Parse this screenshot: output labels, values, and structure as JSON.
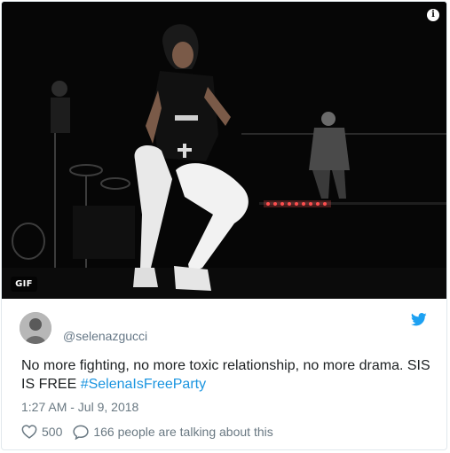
{
  "media": {
    "badge": "GIF",
    "info_icon": "info-icon",
    "alt_description_icon": "i"
  },
  "tweet": {
    "handle": "@selenazgucci",
    "text_main": "No more fighting, no more toxic relationship, no more drama. SIS IS FREE ",
    "hashtag": "#SelenaIsFreeParty",
    "timestamp": "1:27 AM - Jul 9, 2018",
    "likes": "500",
    "talking": "166 people are talking about this"
  },
  "colors": {
    "link": "#1b95e0",
    "text": "#1c2022",
    "muted": "#697882",
    "twitter_blue": "#1da1f2"
  },
  "icons": [
    "info-icon",
    "twitter-bird-icon",
    "heart-icon",
    "speech-bubble-icon"
  ]
}
